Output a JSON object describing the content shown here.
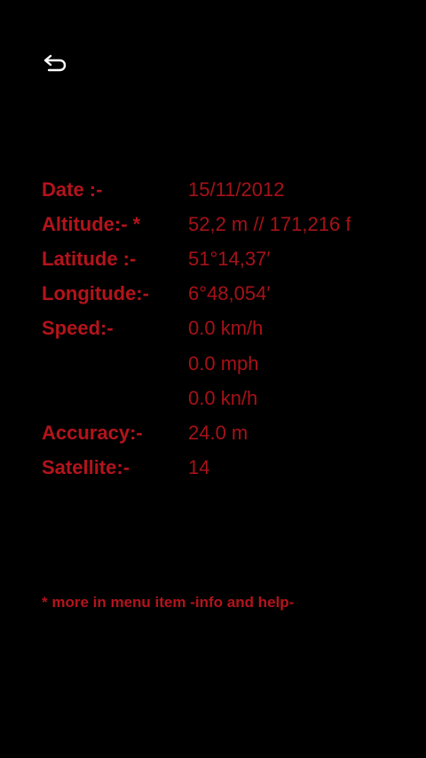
{
  "nav": {
    "back_icon": "back-arrow-icon"
  },
  "rows": [
    {
      "label": "Date :-",
      "value": "15/11/2012"
    },
    {
      "label": "Altitude:- *",
      "value": "52,2 m // 171,216 f"
    },
    {
      "label": "Latitude :-",
      "value": "51°14,37′"
    },
    {
      "label": "Longitude:-",
      "value": "6°48,054′"
    },
    {
      "label": "Speed:-",
      "value": "0.0 km/h"
    },
    {
      "label": "",
      "value": "0.0 mph"
    },
    {
      "label": "",
      "value": "0.0 kn/h"
    },
    {
      "label": "Accuracy:-",
      "value": "24.0 m"
    },
    {
      "label": "Satellite:-",
      "value": "14"
    }
  ],
  "footnote": "* more in menu item -info and help-",
  "colors": {
    "background": "#000000",
    "label": "#b3141b",
    "value": "#a61218",
    "icon": "#ffffff"
  }
}
